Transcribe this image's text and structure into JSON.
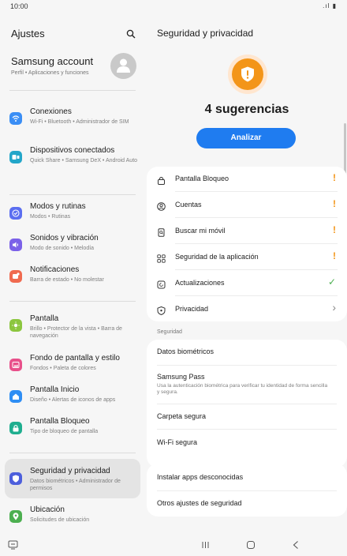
{
  "status": {
    "time": "10:00",
    "icons": ".ıl ▮"
  },
  "left": {
    "title": "Ajustes",
    "account": {
      "title": "Samsung account",
      "subtitle": "Perfil • Aplicaciones y funciones"
    },
    "items": [
      {
        "title": "Conexiones",
        "subtitle": "Wi-Fi • Bluetooth • Administrador de SIM",
        "color": "#3a8ef5"
      },
      {
        "title": "Dispositivos conectados",
        "subtitle": "Quick Share • Samsung DeX • Android Auto",
        "color": "#23a6c9"
      },
      {
        "title": "Modos y rutinas",
        "subtitle": "Modos • Rutinas",
        "color": "#5b6ef0"
      },
      {
        "title": "Sonidos y vibración",
        "subtitle": "Modo de sonido • Melodía",
        "color": "#7b61e8"
      },
      {
        "title": "Notificaciones",
        "subtitle": "Barra de estado • No molestar",
        "color": "#f06a4f"
      },
      {
        "title": "Pantalla",
        "subtitle": "Brillo • Protector de la vista • Barra de navegación",
        "color": "#8cc63f"
      },
      {
        "title": "Fondo de pantalla y estilo",
        "subtitle": "Fondos • Paleta de colores",
        "color": "#e8508a"
      },
      {
        "title": "Pantalla Inicio",
        "subtitle": "Diseño • Alertas de iconos de apps",
        "color": "#2f8ef4"
      },
      {
        "title": "Pantalla Bloqueo",
        "subtitle": "Tipo de bloqueo de pantalla",
        "color": "#1fae8f"
      },
      {
        "title": "Seguridad y privacidad",
        "subtitle": "Datos biométricos • Administrador de permisos",
        "color": "#4d5fdc"
      },
      {
        "title": "Ubicación",
        "subtitle": "Solicitudes de ubicación",
        "color": "#4caf50"
      }
    ]
  },
  "right": {
    "title": "Seguridad y privacidad",
    "suggestions": "4 sugerencias",
    "analyze_label": "Analizar",
    "checks": [
      {
        "label": "Pantalla Bloqueo",
        "icon": "lock-icon",
        "status": "!"
      },
      {
        "label": "Cuentas",
        "icon": "account-icon",
        "status": "!"
      },
      {
        "label": "Buscar mi móvil",
        "icon": "find-phone-icon",
        "status": "!"
      },
      {
        "label": "Seguridad de la aplicación",
        "icon": "apps-grid-icon",
        "status": "!"
      },
      {
        "label": "Actualizaciones",
        "icon": "update-icon",
        "status": "✓"
      },
      {
        "label": "Privacidad",
        "icon": "privacy-shield-icon",
        "status": "›"
      }
    ],
    "section_label": "Seguridad",
    "security_items": [
      {
        "title": "Datos biométricos",
        "subtitle": ""
      },
      {
        "title": "Samsung Pass",
        "subtitle": "Usa la autenticación biométrica para verificar tu identidad de forma sencilla y segura."
      },
      {
        "title": "Carpeta segura",
        "subtitle": ""
      },
      {
        "title": "Wi-Fi segura",
        "subtitle": ""
      }
    ],
    "other_items": [
      {
        "title": "Instalar apps desconocidas"
      },
      {
        "title": "Otros ajustes de seguridad"
      }
    ]
  },
  "colors": {
    "accent": "#1f7cf0",
    "warning": "#f39519",
    "ok": "#4caf50"
  }
}
